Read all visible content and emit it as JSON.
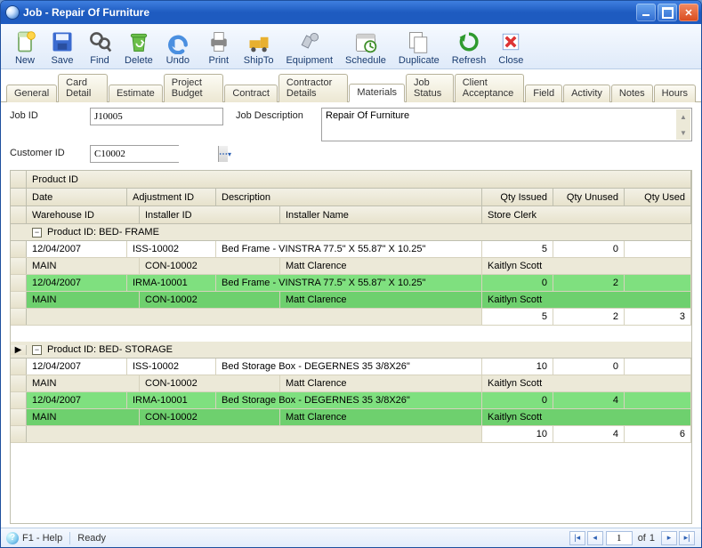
{
  "window": {
    "title": "Job - Repair Of Furniture"
  },
  "toolbar": {
    "new": "New",
    "save": "Save",
    "find": "Find",
    "delete": "Delete",
    "undo": "Undo",
    "print": "Print",
    "shipto": "ShipTo",
    "equipment": "Equipment",
    "schedule": "Schedule",
    "duplicate": "Duplicate",
    "refresh": "Refresh",
    "close": "Close"
  },
  "tabs": {
    "general": "General",
    "card_detail": "Card Detail",
    "estimate": "Estimate",
    "project_budget": "Project Budget",
    "contract": "Contract",
    "contractor_details": "Contractor Details",
    "materials": "Materials",
    "job_status": "Job Status",
    "client_acceptance": "Client Acceptance",
    "field": "Field",
    "activity": "Activity",
    "notes": "Notes",
    "hours": "Hours"
  },
  "form": {
    "job_id_label": "Job ID",
    "job_id": "J10005",
    "customer_id_label": "Customer ID",
    "customer_id": "C10002",
    "job_desc_label": "Job Description",
    "job_desc": "Repair Of Furniture"
  },
  "grid": {
    "headers": {
      "product_id": "Product ID",
      "date": "Date",
      "adjustment_id": "Adjustment ID",
      "description": "Description",
      "qty_issued": "Qty Issued",
      "qty_unused": "Qty Unused",
      "qty_used": "Qty Used",
      "warehouse_id": "Warehouse ID",
      "installer_id": "Installer ID",
      "installer_name": "Installer Name",
      "store_clerk": "Store Clerk"
    },
    "groups": [
      {
        "label": "Product ID: BED- FRAME",
        "rows": [
          {
            "date": "12/04/2007",
            "adj": "ISS-10002",
            "desc": "Bed Frame - VINSTRA 77.5\" X 55.87\" X 10.25\"",
            "qi": "5",
            "qu": "0",
            "qd": "",
            "wh": "MAIN",
            "ins": "CON-10002",
            "inn": "Matt Clarence",
            "clerk": "Kaitlyn Scott",
            "green": false
          },
          {
            "date": "12/04/2007",
            "adj": "IRMA-10001",
            "desc": "Bed Frame - VINSTRA 77.5\" X 55.87\" X 10.25\"",
            "qi": "0",
            "qu": "2",
            "qd": "",
            "wh": "MAIN",
            "ins": "CON-10002",
            "inn": "Matt Clarence",
            "clerk": "Kaitlyn Scott",
            "green": true
          }
        ],
        "totals": {
          "qi": "5",
          "qu": "2",
          "qd": "3"
        },
        "indicator": false
      },
      {
        "label": "Product ID: BED- STORAGE",
        "rows": [
          {
            "date": "12/04/2007",
            "adj": "ISS-10002",
            "desc": "Bed Storage Box - DEGERNES 35 3/8X26\"",
            "qi": "10",
            "qu": "0",
            "qd": "",
            "wh": "MAIN",
            "ins": "CON-10002",
            "inn": "Matt Clarence",
            "clerk": "Kaitlyn Scott",
            "green": false
          },
          {
            "date": "12/04/2007",
            "adj": "IRMA-10001",
            "desc": "Bed Storage Box - DEGERNES 35 3/8X26\"",
            "qi": "0",
            "qu": "4",
            "qd": "",
            "wh": "MAIN",
            "ins": "CON-10002",
            "inn": "Matt Clarence",
            "clerk": "Kaitlyn Scott",
            "green": true
          }
        ],
        "totals": {
          "qi": "10",
          "qu": "4",
          "qd": "6"
        },
        "indicator": true
      }
    ]
  },
  "status": {
    "help": "F1 - Help",
    "ready": "Ready",
    "page": "1",
    "of": "of",
    "pages": "1"
  }
}
